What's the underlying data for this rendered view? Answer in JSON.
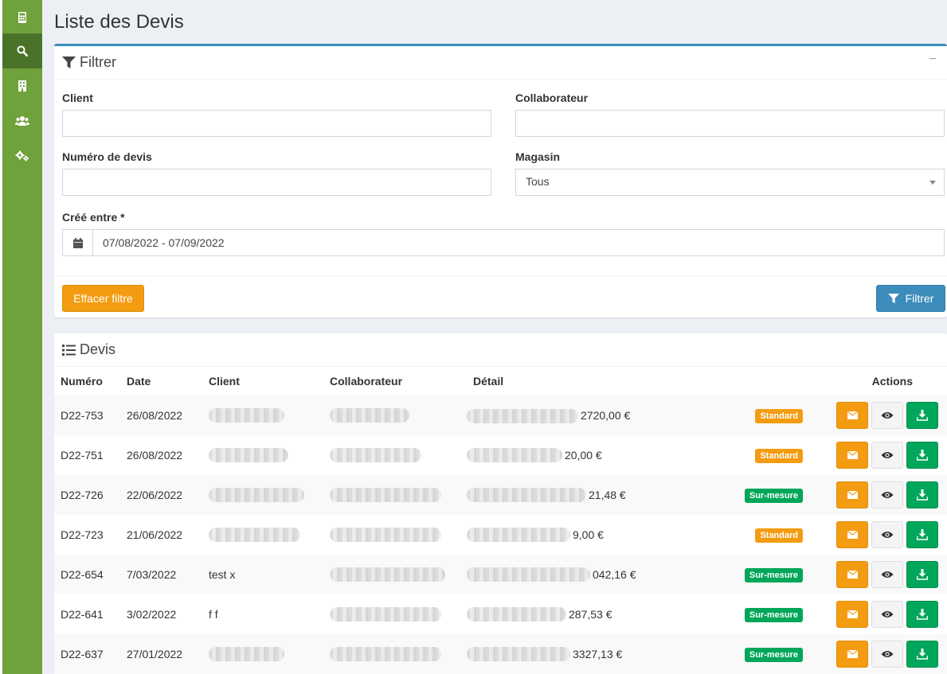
{
  "sidebar": {
    "items": [
      {
        "icon": "calculator-icon"
      },
      {
        "icon": "search-icon",
        "active": true
      },
      {
        "icon": "building-icon"
      },
      {
        "icon": "users-icon"
      },
      {
        "icon": "cogs-icon"
      }
    ]
  },
  "page": {
    "title": "Liste des Devis"
  },
  "filter": {
    "title": "Filtrer",
    "collapse": "−",
    "client_label": "Client",
    "client_value": "",
    "collab_label": "Collaborateur",
    "collab_value": "",
    "numero_label": "Numéro de devis",
    "numero_value": "",
    "magasin_label": "Magasin",
    "magasin_value": "Tous",
    "date_label": "Créé entre *",
    "date_value": "07/08/2022 - 07/09/2022",
    "clear_button": "Effacer filtre",
    "filter_button": "Filtrer"
  },
  "list": {
    "title": "Devis",
    "columns": [
      "Numéro",
      "Date",
      "Client",
      "Collaborateur",
      "Détail",
      "",
      "Actions"
    ],
    "rows": [
      {
        "numero": "D22-753",
        "date": "26/08/2022",
        "client": "",
        "collab": "",
        "detail": "2720,00 €",
        "type": "Standard"
      },
      {
        "numero": "D22-751",
        "date": "26/08/2022",
        "client": "",
        "collab": "",
        "detail": "20,00 €",
        "type": "Standard"
      },
      {
        "numero": "D22-726",
        "date": "22/06/2022",
        "client": "",
        "collab": "",
        "detail": "21,48 €",
        "type": "Sur-mesure"
      },
      {
        "numero": "D22-723",
        "date": "21/06/2022",
        "client": "",
        "collab": "",
        "detail": "9,00 €",
        "type": "Standard"
      },
      {
        "numero": "D22-654",
        "date": "7/03/2022",
        "client": "test x",
        "collab": "",
        "detail": "042,16 €",
        "type": "Sur-mesure"
      },
      {
        "numero": "D22-641",
        "date": "3/02/2022",
        "client": "f f",
        "collab": "",
        "detail": "287,53 €",
        "type": "Sur-mesure"
      },
      {
        "numero": "D22-637",
        "date": "27/01/2022",
        "client": "",
        "collab": "",
        "detail": "3327,13 €",
        "type": "Sur-mesure"
      }
    ]
  },
  "colors": {
    "sidebar": "#6fa23a",
    "sidebar_active": "#4a7329",
    "primary": "#3c8dbc",
    "warning": "#f39c12",
    "success": "#00a65a"
  }
}
